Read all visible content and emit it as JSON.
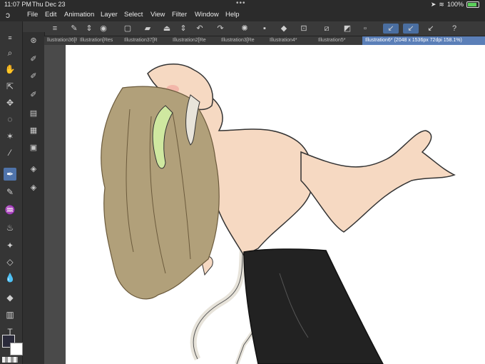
{
  "status": {
    "time": "11:07 PM",
    "date": "Thu Dec 23",
    "battery": "100%"
  },
  "menu": [
    "File",
    "Edit",
    "Animation",
    "Layer",
    "Select",
    "View",
    "Filter",
    "Window",
    "Help"
  ],
  "tabs": [
    {
      "label": "llustration36[Re"
    },
    {
      "label": "Illustration[Res"
    },
    {
      "label": "Illustration37[R"
    },
    {
      "label": "Illustration2[Re"
    },
    {
      "label": "Illustration3[Re"
    },
    {
      "label": "Illustration4*"
    },
    {
      "label": "Illustration5*"
    },
    {
      "label": "Illustration6* (2048 x 1536px 72dpi 158.1%)"
    }
  ],
  "colors": {
    "accent": "#5b7fb8",
    "main_color": "#2a2a3a",
    "sub_color": "#ffffff"
  }
}
